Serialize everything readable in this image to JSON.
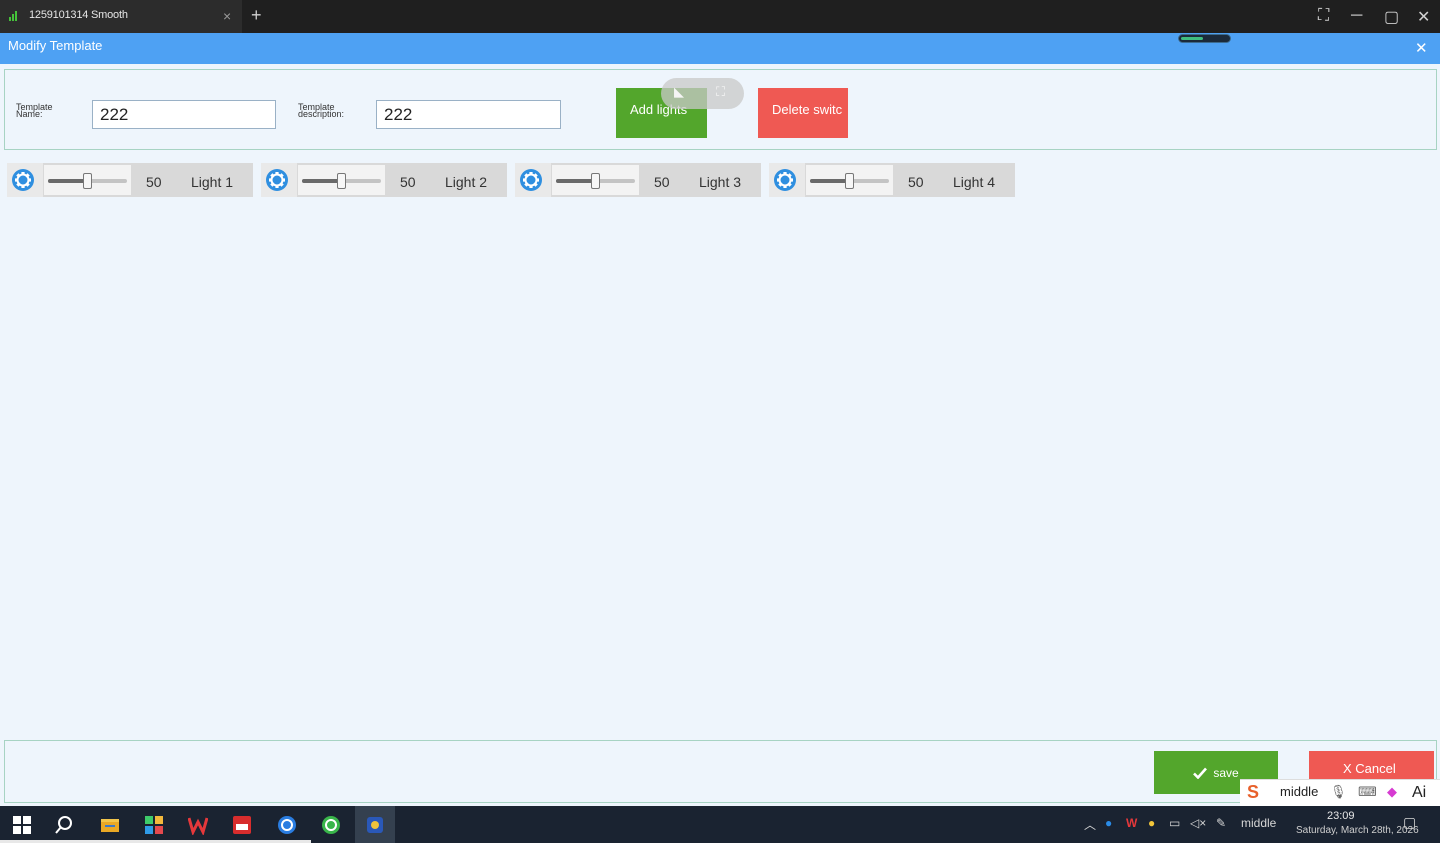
{
  "browser": {
    "tab_title": "1259101314 Smooth",
    "tab_close": "×",
    "new_tab": "+",
    "fullscreen_icon": "⛶",
    "minimize_icon": "─",
    "maximize_icon": "▢",
    "close_icon": "✕"
  },
  "dialog": {
    "title": "Modify Template",
    "close_icon": "✕",
    "loading_progress": 0.45
  },
  "form": {
    "name_label_line1": "Template",
    "name_label_line2": "Name:",
    "name_value": "222",
    "desc_label_line1": "Template",
    "desc_label_line2": "description:",
    "desc_value": "222",
    "add_lights_label": "Add lights",
    "delete_label": "Delete switc"
  },
  "overlay": {
    "collapse_icon": "◣",
    "expand_icon": "⛶"
  },
  "lights": [
    {
      "value": "50",
      "label": "Light 1",
      "level": 0.5
    },
    {
      "value": "50",
      "label": "Light 2",
      "level": 0.5
    },
    {
      "value": "50",
      "label": "Light 3",
      "level": 0.5
    },
    {
      "value": "50",
      "label": "Light 4",
      "level": 0.5
    }
  ],
  "footer": {
    "save_label": "save",
    "cancel_label": "X Cancel"
  },
  "ime": {
    "mode_text": "middle",
    "ai_text": "Ai"
  },
  "taskbar": {
    "tray_text": "middle",
    "time": "23:09",
    "date": "Saturday, March 28th, 2026"
  },
  "colors": {
    "header_blue": "#4ea1f3",
    "add_green": "#53a62c",
    "delete_red": "#ef5953",
    "gear_blue": "#2f8fe0"
  }
}
